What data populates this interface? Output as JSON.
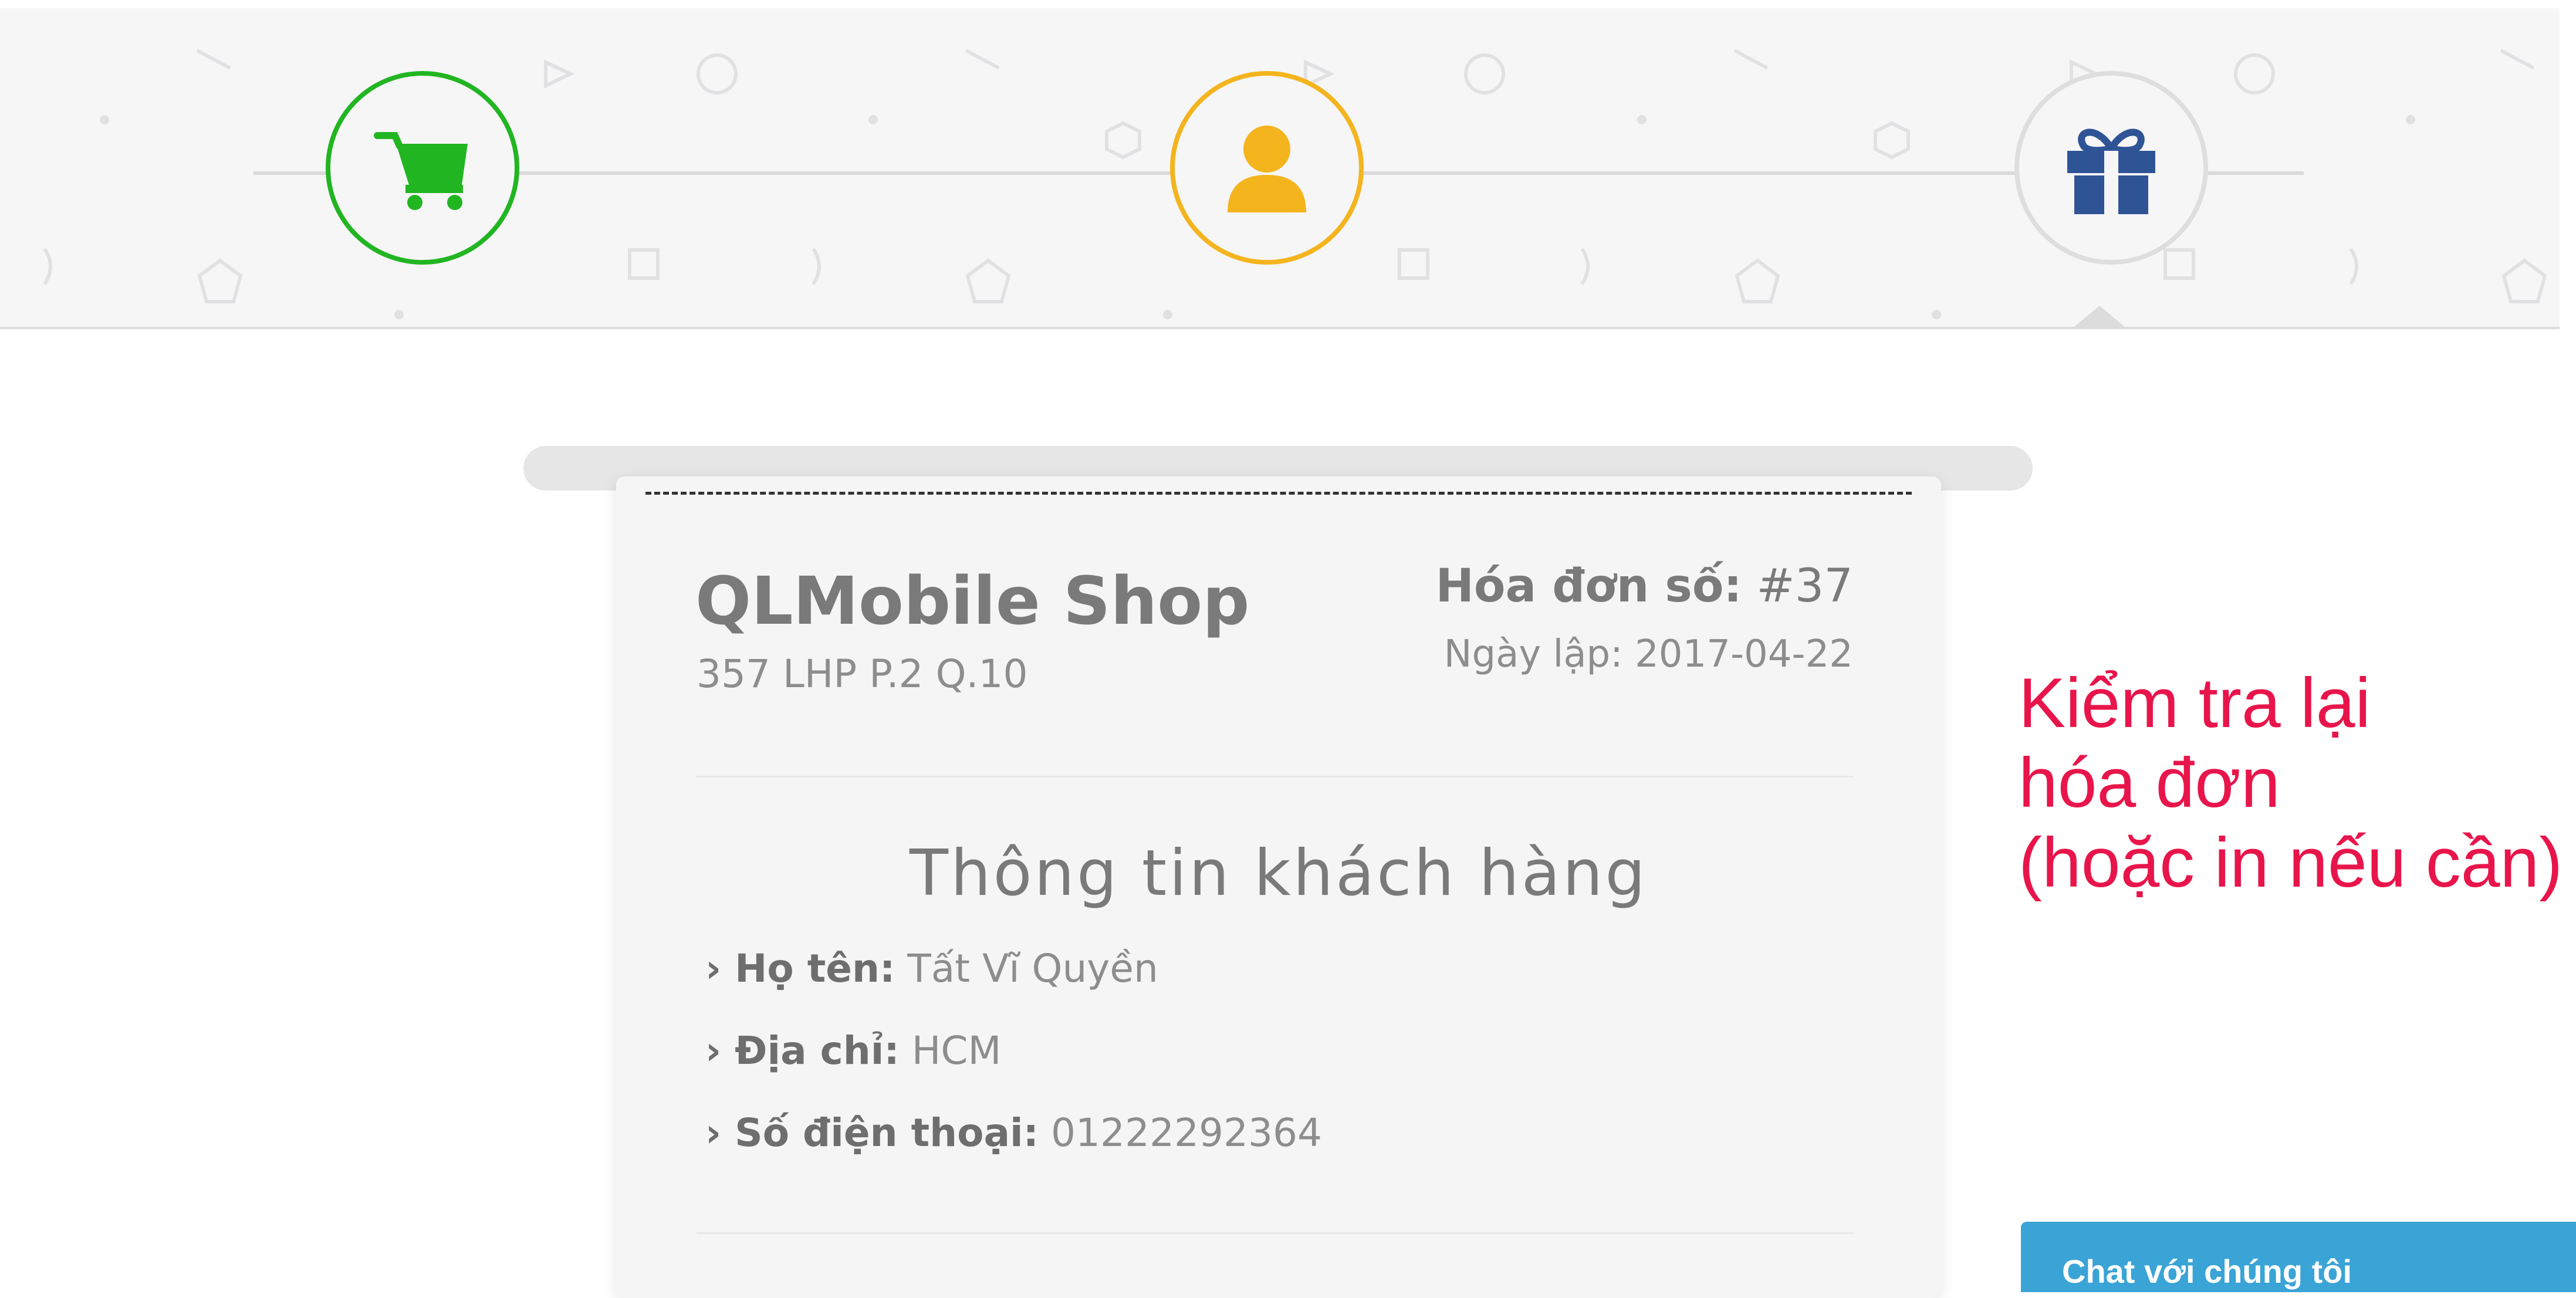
{
  "stepper": {
    "steps": [
      {
        "icon": "shopping-cart-icon",
        "color": "#22b522",
        "state": "completed"
      },
      {
        "icon": "user-icon",
        "color": "#f4b41e",
        "state": "completed"
      },
      {
        "icon": "gift-icon",
        "color": "#2f5496",
        "state": "active"
      }
    ]
  },
  "receipt": {
    "shop_name": "QLMobile Shop",
    "shop_address": "357 LHP P.2 Q.10",
    "invoice_label": "Hóa đơn số:",
    "invoice_number": "#37",
    "date_label": "Ngày lập:",
    "date_value": "2017-04-22",
    "section_title": "Thông tin khách hàng",
    "customer": [
      {
        "label": "› Họ tên:",
        "value": "Tất Vĩ Quyền"
      },
      {
        "label": "› Địa chỉ:",
        "value": "HCM"
      },
      {
        "label": "› Số điện thoại:",
        "value": "01222292364"
      }
    ]
  },
  "annotation": {
    "lines": [
      "Kiểm tra lại",
      "hóa đơn",
      "(hoặc in nếu cần)"
    ],
    "color": "#e8154b"
  },
  "chat": {
    "label": "Chat với chúng tôi"
  }
}
